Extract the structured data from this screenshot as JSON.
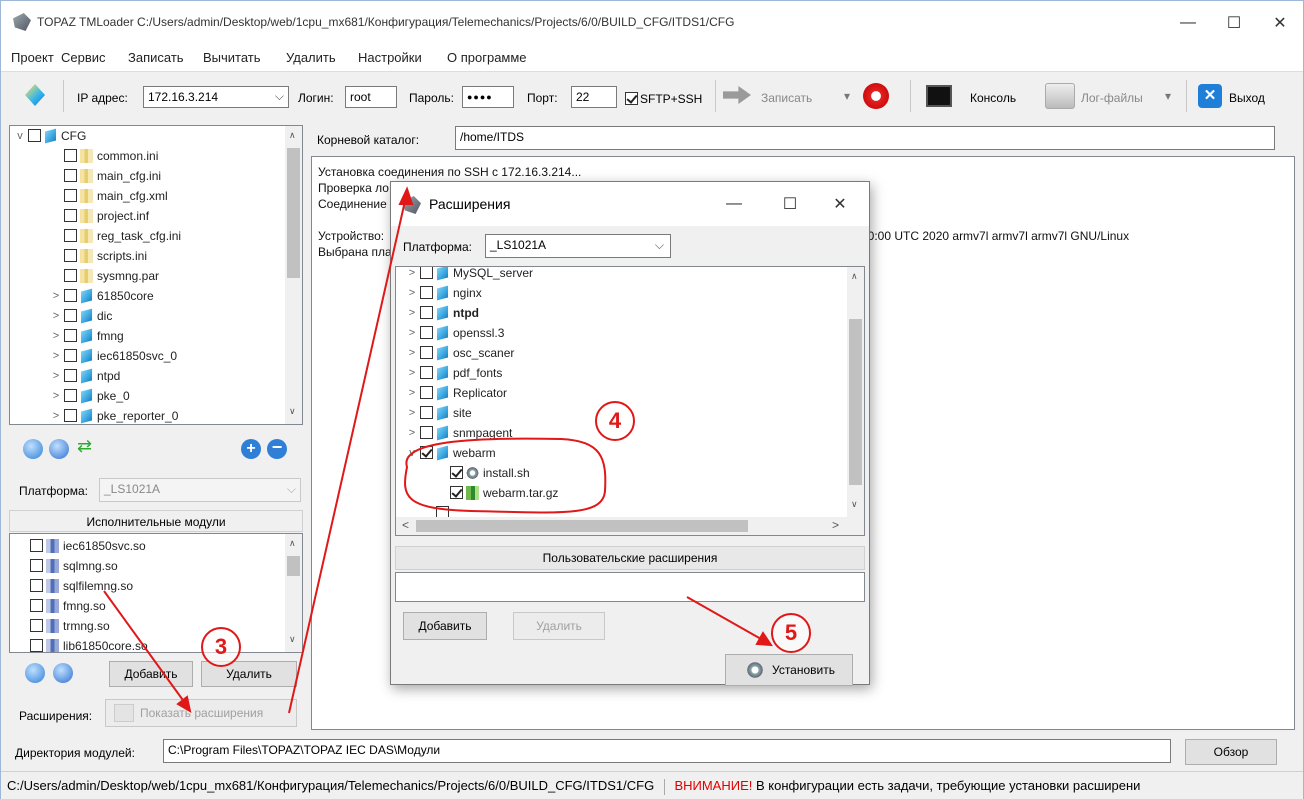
{
  "window": {
    "title": "TOPAZ TMLoader C:/Users/admin/Desktop/web/1cpu_mx681/Конфигурация/Telemechanics/Projects/6/0/BUILD_CFG/ITDS1/CFG",
    "minimize": "—",
    "maximize": "☐",
    "close": "✕"
  },
  "menu": [
    "Проект",
    "Сервис",
    "Записать",
    "Вычитать",
    "Удалить",
    "Настройки",
    "О программе"
  ],
  "toolbar": {
    "ip_label": "IP адрес:",
    "ip_value": "172.16.3.214",
    "login_label": "Логин:",
    "login_value": "root",
    "password_label": "Пароль:",
    "password_value": "●●●●",
    "port_label": "Порт:",
    "port_value": "22",
    "sftp_label": "SFTP+SSH",
    "write_label": "Записать",
    "console_label": "Консоль",
    "logs_label": "Лог-файлы",
    "exit_label": "Выход"
  },
  "project_tree": [
    {
      "label": "CFG",
      "type": "folder",
      "level": 0,
      "expander": "v"
    },
    {
      "label": "common.ini",
      "type": "file",
      "level": 1,
      "expander": ""
    },
    {
      "label": "main_cfg.ini",
      "type": "file",
      "level": 1,
      "expander": ""
    },
    {
      "label": "main_cfg.xml",
      "type": "file",
      "level": 1,
      "expander": ""
    },
    {
      "label": "project.inf",
      "type": "file",
      "level": 1,
      "expander": ""
    },
    {
      "label": "reg_task_cfg.ini",
      "type": "file",
      "level": 1,
      "expander": ""
    },
    {
      "label": "scripts.ini",
      "type": "file",
      "level": 1,
      "expander": ""
    },
    {
      "label": "sysmng.par",
      "type": "file",
      "level": 1,
      "expander": ""
    },
    {
      "label": "61850core",
      "type": "folder",
      "level": 1,
      "expander": ">"
    },
    {
      "label": "dic",
      "type": "folder",
      "level": 1,
      "expander": ">"
    },
    {
      "label": "fmng",
      "type": "folder",
      "level": 1,
      "expander": ">"
    },
    {
      "label": "iec61850svc_0",
      "type": "folder",
      "level": 1,
      "expander": ">"
    },
    {
      "label": "ntpd",
      "type": "folder",
      "level": 1,
      "expander": ">"
    },
    {
      "label": "pke_0",
      "type": "folder",
      "level": 1,
      "expander": ">"
    },
    {
      "label": "pke_reporter_0",
      "type": "folder",
      "level": 1,
      "expander": ">"
    }
  ],
  "left": {
    "platform_label": "Платформа:",
    "platform_value": "_LS1021A",
    "modules_header": "Исполнительные модули",
    "modules": [
      "iec61850svc.so",
      "sqlmng.so",
      "sqlfilemng.so",
      "fmng.so",
      "trmng.so",
      "lib61850core.so"
    ],
    "add_label": "Добавить",
    "delete_label": "Удалить",
    "ext_label": "Расширения:",
    "show_ext_label": "Показать расширения"
  },
  "main": {
    "root_label": "Корневой каталог:",
    "root_value": "/home/ITDS",
    "log": [
      "Установка соединения по SSH с 172.16.3.214...",
      "Проверка ло",
      "Соединение",
      "",
      "Устройство:",
      "Выбрана пла"
    ],
    "log_tail": "00:00 UTC 2020 armv7l armv7l armv7l GNU/Linux"
  },
  "dialog": {
    "title": "Расширения",
    "platform_label": "Платформа:",
    "platform_value": "_LS1021A",
    "items": [
      {
        "label": "MySQL_server",
        "bold": false,
        "checked": false,
        "level": 0,
        "expander": ">",
        "type": "folder"
      },
      {
        "label": "nginx",
        "bold": false,
        "checked": false,
        "level": 0,
        "expander": ">",
        "type": "folder"
      },
      {
        "label": "ntpd",
        "bold": true,
        "checked": false,
        "level": 0,
        "expander": ">",
        "type": "folder"
      },
      {
        "label": "openssl.3",
        "bold": false,
        "checked": false,
        "level": 0,
        "expander": ">",
        "type": "folder"
      },
      {
        "label": "osc_scaner",
        "bold": false,
        "checked": false,
        "level": 0,
        "expander": ">",
        "type": "folder"
      },
      {
        "label": "pdf_fonts",
        "bold": false,
        "checked": false,
        "level": 0,
        "expander": ">",
        "type": "folder"
      },
      {
        "label": "Replicator",
        "bold": false,
        "checked": false,
        "level": 0,
        "expander": ">",
        "type": "folder"
      },
      {
        "label": "site",
        "bold": false,
        "checked": false,
        "level": 0,
        "expander": ">",
        "type": "folder"
      },
      {
        "label": "snmpagent",
        "bold": false,
        "checked": false,
        "level": 0,
        "expander": ">",
        "type": "folder"
      },
      {
        "label": "webarm",
        "bold": false,
        "checked": true,
        "level": 0,
        "expander": "v",
        "type": "folder"
      },
      {
        "label": "install.sh",
        "bold": false,
        "checked": true,
        "level": 1,
        "expander": "",
        "type": "gear"
      },
      {
        "label": "webarm.tar.gz",
        "bold": false,
        "checked": true,
        "level": 1,
        "expander": "",
        "type": "arc"
      }
    ],
    "user_ext_header": "Пользовательские расширения",
    "add_label": "Добавить",
    "delete_label": "Удалить",
    "install_label": "Установить"
  },
  "bottom": {
    "modules_dir_label": "Директория модулей:",
    "modules_dir_value": "C:\\Program Files\\TOPAZ\\TOPAZ IEC DAS\\Модули",
    "browse_label": "Обзор"
  },
  "status": {
    "path": "C:/Users/admin/Desktop/web/1cpu_mx681/Конфигурация/Telemechanics/Projects/6/0/BUILD_CFG/ITDS1/CFG",
    "warning_word": "ВНИМАНИЕ!",
    "warning_text": " В конфигурации есть задачи, требующие установки расширени"
  },
  "annotations": [
    "3",
    "4",
    "5"
  ],
  "colors": {
    "annotation": "#e01818",
    "warning": "#e00000",
    "accent": "#1f7fd8"
  }
}
